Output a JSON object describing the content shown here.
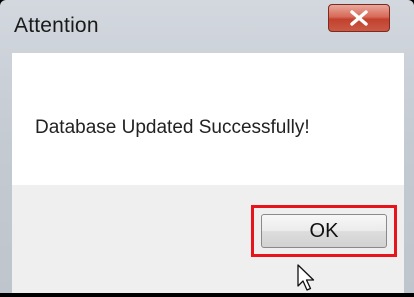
{
  "dialog": {
    "title": "Attention",
    "message": "Database Updated Successfully!",
    "ok_label": "OK",
    "close_icon": "close-icon",
    "highlight_color": "#e8141c",
    "close_button_color": "#c9402e"
  }
}
